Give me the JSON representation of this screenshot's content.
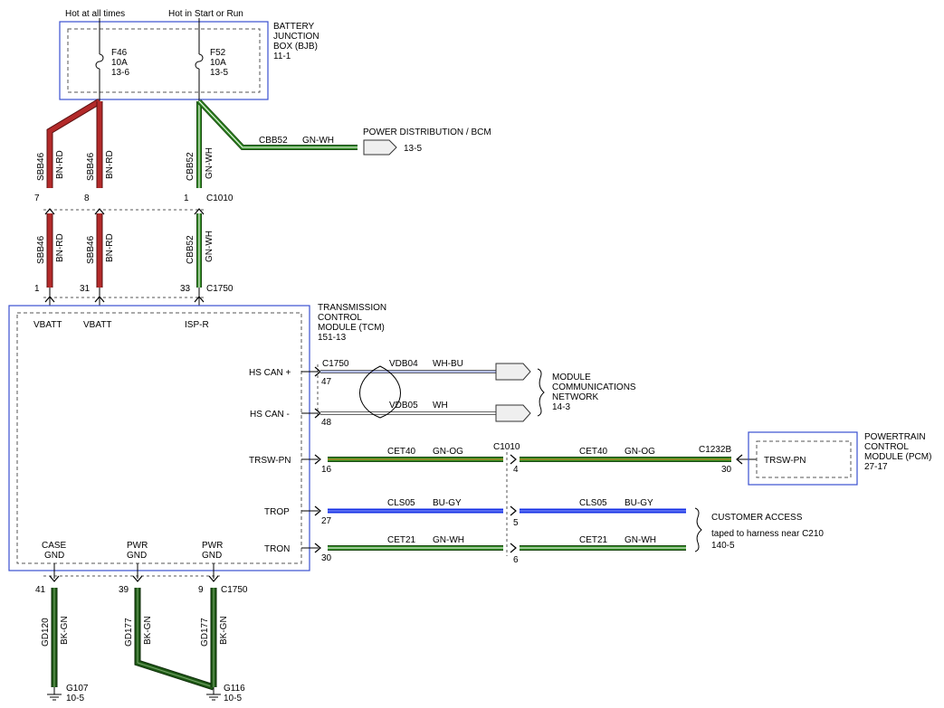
{
  "bjb": {
    "feed_left": "Hot at all times",
    "feed_right": "Hot in Start or Run",
    "label": [
      "BATTERY",
      "JUNCTION",
      "BOX (BJB)",
      "11-1"
    ],
    "fuse_left": [
      "F46",
      "10A",
      "13-6"
    ],
    "fuse_right": [
      "F52",
      "10A",
      "13-5"
    ]
  },
  "power_dist": {
    "circuit": "CBB52",
    "color": "GN-WH",
    "title": "POWER DISTRIBUTION / BCM",
    "page": "13-5"
  },
  "upper_wires": {
    "w1": {
      "circuit": "SBB46",
      "color": "BN-RD"
    },
    "w2": {
      "circuit": "SBB46",
      "color": "BN-RD"
    },
    "w3": {
      "circuit": "CBB52",
      "color": "GN-WH"
    }
  },
  "c1010_top": {
    "pin1": "7",
    "pin2": "8",
    "pin3": "1",
    "name": "C1010"
  },
  "lower_wires": {
    "w1": {
      "circuit": "SBB46",
      "color": "BN-RD"
    },
    "w2": {
      "circuit": "SBB46",
      "color": "BN-RD"
    },
    "w3": {
      "circuit": "CBB52",
      "color": "GN-WH"
    }
  },
  "c1750_top": {
    "pin1": "1",
    "pin2": "31",
    "pin3": "33",
    "name": "C1750"
  },
  "tcm": {
    "label": [
      "TRANSMISSION",
      "CONTROL",
      "MODULE (TCM)",
      "151-13"
    ],
    "pin_vbatt1": "VBATT",
    "pin_vbatt2": "VBATT",
    "pin_ispr": "ISP-R",
    "hs_can_plus": "HS CAN +",
    "hs_can_minus": "HS CAN -",
    "trsw_pn": "TRSW-PN",
    "trop": "TROP",
    "tron": "TRON",
    "case_gnd": [
      "CASE",
      "GND"
    ],
    "pwr_gnd1": [
      "PWR",
      "GND"
    ],
    "pwr_gnd2": [
      "PWR",
      "GND"
    ]
  },
  "can": {
    "connector": "C1750",
    "pin_plus": "47",
    "pin_minus": "48",
    "plus_circuit": "VDB04",
    "plus_color": "WH-BU",
    "minus_circuit": "VDB05",
    "minus_color": "WH",
    "network": [
      "MODULE",
      "COMMUNICATIONS",
      "NETWORK",
      "14-3"
    ]
  },
  "trsw": {
    "pin_tcm": "16",
    "circuit_left": "CET40",
    "color_left": "GN-OG",
    "c1010": "C1010",
    "pin_c1010": "4",
    "circuit_right": "CET40",
    "color_right": "GN-OG",
    "c1232b": "C1232B",
    "pin_pcm": "30"
  },
  "pcm": {
    "pin": "TRSW-PN",
    "label": [
      "POWERTRAIN",
      "CONTROL",
      "MODULE (PCM)",
      "27-17"
    ]
  },
  "trop": {
    "pin_tcm": "27",
    "circuit_left": "CLS05",
    "color_left": "BU-GY",
    "pin_c1010": "5",
    "circuit_right": "CLS05",
    "color_right": "BU-GY"
  },
  "tron": {
    "pin_tcm": "30",
    "circuit_left": "CET21",
    "color_left": "GN-WH",
    "pin_c1010": "6",
    "circuit_right": "CET21",
    "color_right": "GN-WH"
  },
  "customer_access": {
    "title": "CUSTOMER ACCESS",
    "note": "taped to harness near C210",
    "page": "140-5"
  },
  "grounds": {
    "pin1": "41",
    "pin2": "39",
    "pin3": "9",
    "connector": "C1750",
    "w1_circuit": "GD120",
    "w1_color": "BK-GN",
    "w2_circuit": "GD177",
    "w2_color": "BK-GN",
    "w3_circuit": "GD177",
    "w3_color": "BK-GN",
    "g107": "G107",
    "g107_page": "10-5",
    "g116": "G116",
    "g116_page": "10-5"
  }
}
